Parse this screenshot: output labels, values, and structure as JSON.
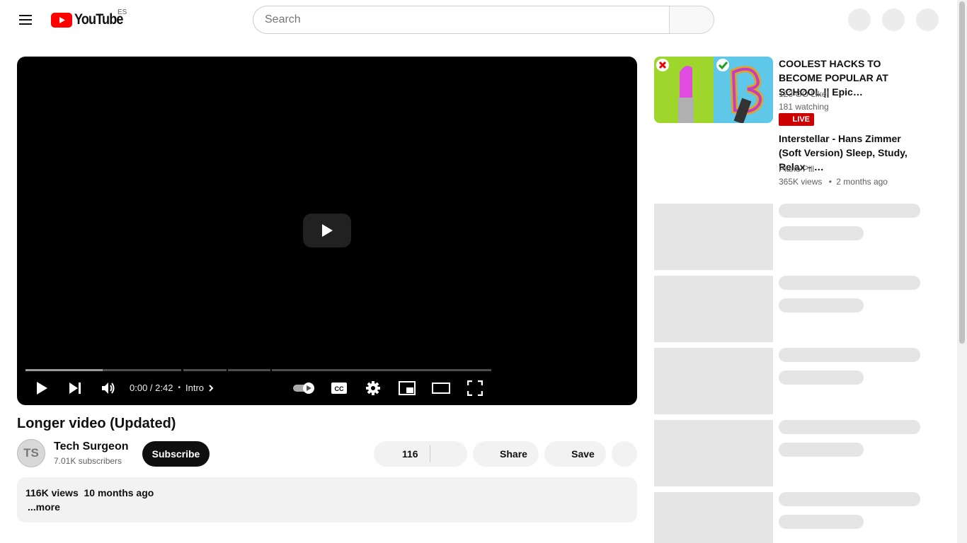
{
  "masthead": {
    "logo_text": "YouTube",
    "region": "ES",
    "search_placeholder": "Search"
  },
  "player": {
    "time_current": "0:00",
    "time_separator": " / ",
    "time_total": "2:42",
    "chapter_label": "Intro",
    "played_fraction": 0.0
  },
  "video": {
    "title": "Longer video (Updated)",
    "channel_name": "Tech Surgeon",
    "channel_initials": "TS",
    "subscribers": "7.01K subscribers",
    "subscribe_label": "Subscribe",
    "likes": "116",
    "share_label": "Share",
    "save_label": "Save",
    "views": "116K views",
    "uploaded": "10 months ago",
    "more_label": "...more"
  },
  "recommendations": [
    {
      "title": "COOLEST HACKS TO BECOME POPULAR AT SCHOOL || Epic…",
      "channel": "123 GO Like!",
      "stats": "181 watching",
      "badge": "LIVE"
    },
    {
      "title": "Interstellar - Hans Zimmer (Soft Version) Sleep, Study, Relax - …",
      "channel": "Piano Pill",
      "stats": "365K views",
      "stats_sep": "•",
      "age": "2 months ago"
    }
  ],
  "colors": {
    "brand_red": "#ff0000",
    "live_red": "#cc0000",
    "subscribe_bg": "#0f0f0f"
  }
}
